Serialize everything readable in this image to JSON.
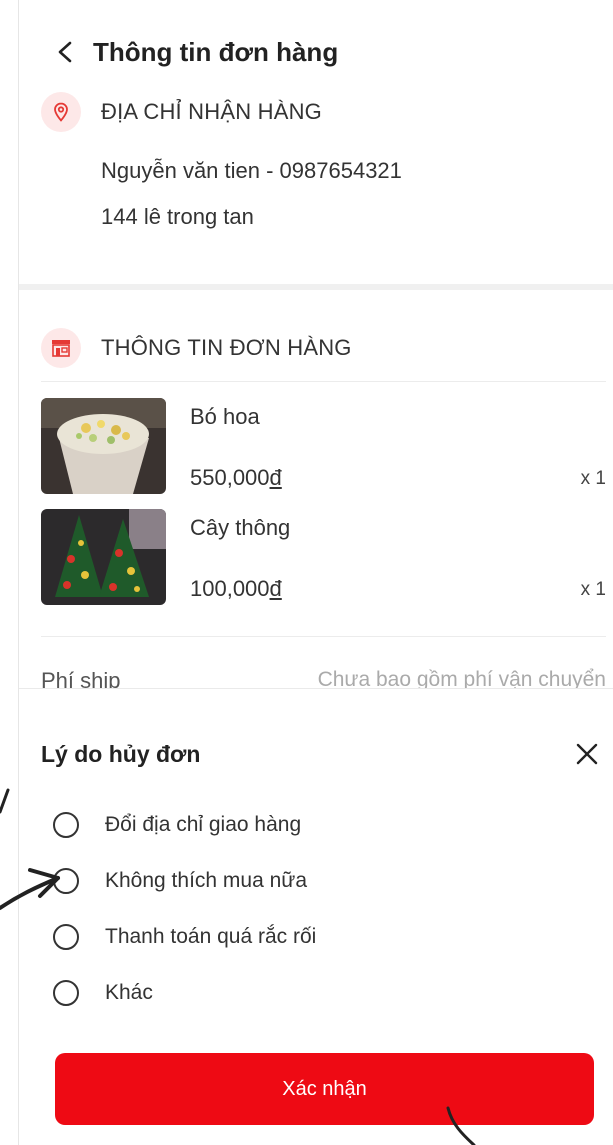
{
  "header": {
    "title": "Thông tin đơn hàng"
  },
  "address": {
    "heading": "ĐỊA CHỈ NHẬN HÀNG",
    "name_phone": "Nguyễn văn tien - 0987654321",
    "street": "144 lê trong tan"
  },
  "order": {
    "heading": "THÔNG TIN ĐƠN HÀNG",
    "items": [
      {
        "name": "Bó hoa",
        "price": "550,000",
        "currency": "đ",
        "qty": "x 1"
      },
      {
        "name": "Cây thông",
        "price": "100,000",
        "currency": "đ",
        "qty": "x 1"
      }
    ],
    "shipping_label": "Phí ship",
    "shipping_value": "Chưa bao gồm phí vận chuyển"
  },
  "cancel_sheet": {
    "title": "Lý do hủy đơn",
    "options": [
      {
        "label": "Đổi địa chỉ giao hàng"
      },
      {
        "label": "Không thích mua nữa"
      },
      {
        "label": "Thanh toán quá rắc rối"
      },
      {
        "label": "Khác"
      }
    ],
    "confirm_label": "Xác nhận"
  },
  "colors": {
    "accent": "#ee0a14",
    "icon_bg": "#fde8e8",
    "icon_red": "#e53935"
  }
}
